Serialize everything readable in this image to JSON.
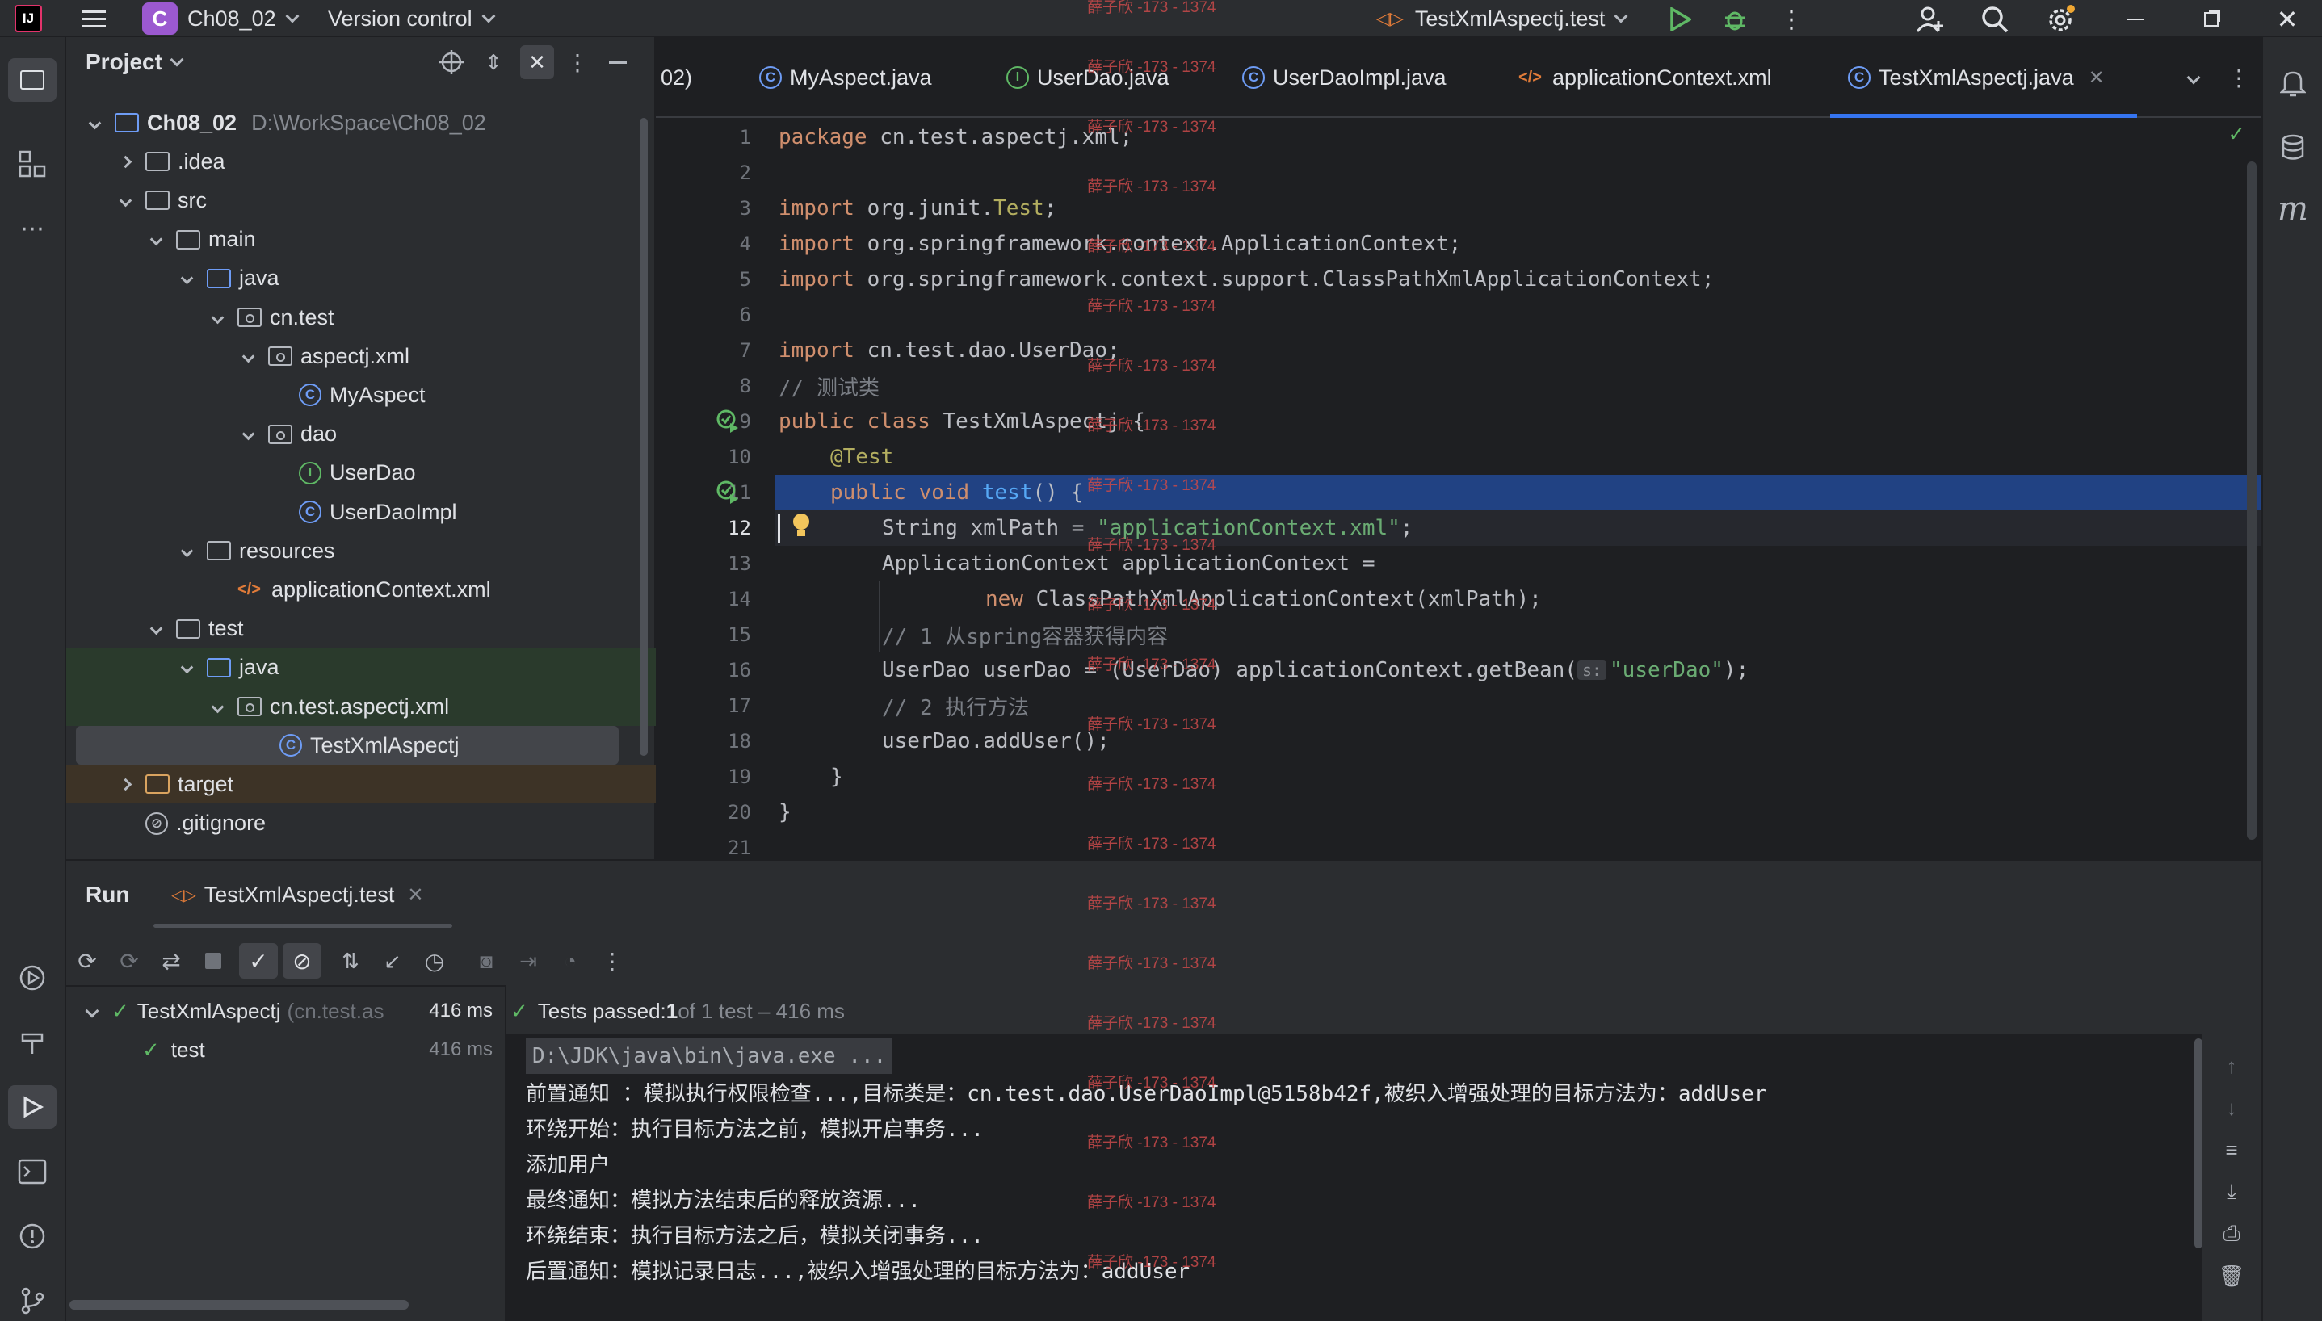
{
  "topbar": {
    "project_badge": "C",
    "project_name": "Ch08_02",
    "vcs": "Version control",
    "run_config": "TestXmlAspectj.test"
  },
  "project_panel": {
    "title": "Project",
    "tree": [
      {
        "label": "Ch08_02",
        "detail": "D:\\WorkSpace\\Ch08_02",
        "icon": "module-folder-icon"
      },
      {
        "label": ".idea",
        "icon": "folder-icon"
      },
      {
        "label": "src",
        "icon": "folder-icon"
      },
      {
        "label": "main",
        "icon": "folder-icon"
      },
      {
        "label": "java",
        "icon": "source-folder-icon"
      },
      {
        "label": "cn.test",
        "icon": "package-icon"
      },
      {
        "label": "aspectj.xml",
        "icon": "package-icon"
      },
      {
        "label": "MyAspect",
        "icon": "class-icon"
      },
      {
        "label": "dao",
        "icon": "package-icon"
      },
      {
        "label": "UserDao",
        "icon": "interface-icon"
      },
      {
        "label": "UserDaoImpl",
        "icon": "class-icon"
      },
      {
        "label": "resources",
        "icon": "resources-folder-icon"
      },
      {
        "label": "applicationContext.xml",
        "icon": "xml-icon"
      },
      {
        "label": "test",
        "icon": "folder-icon"
      },
      {
        "label": "java",
        "icon": "test-source-folder-icon"
      },
      {
        "label": "cn.test.aspectj.xml",
        "icon": "package-icon"
      },
      {
        "label": "TestXmlAspectj",
        "icon": "class-icon"
      },
      {
        "label": "target",
        "icon": "excluded-folder-icon"
      },
      {
        "label": ".gitignore",
        "icon": "ignore-icon"
      }
    ]
  },
  "editor": {
    "tabs": [
      {
        "label": "02)"
      },
      {
        "label": "MyAspect.java"
      },
      {
        "label": "UserDao.java"
      },
      {
        "label": "UserDaoImpl.java"
      },
      {
        "label": "applicationContext.xml"
      },
      {
        "label": "TestXmlAspectj.java"
      }
    ],
    "line_numbers": [
      "1",
      "2",
      "3",
      "4",
      "5",
      "6",
      "7",
      "8",
      "9",
      "10",
      "11",
      "12",
      "13",
      "14",
      "15",
      "16",
      "17",
      "18",
      "19",
      "20",
      "21"
    ],
    "code": {
      "l1_kw": "package",
      "l1_rest": " cn.test.aspectj.xml;",
      "l3_kw": "import",
      "l3_rest": " org.junit.",
      "l3_ann": "Test",
      "l3_end": ";",
      "l4_kw": "import",
      "l4_rest": " org.springframework.context.ApplicationContext;",
      "l5_kw": "import",
      "l5_rest": " org.springframework.context.support.ClassPathXmlApplicationContext;",
      "l7_kw": "import",
      "l7_rest": " cn.test.dao.UserDao;",
      "l8": "// 测试类",
      "l9_kw": "public class",
      "l9_rest": " TestXmlAspectj {",
      "l10": "@Test",
      "l11_kw": "public void",
      "l11_fn": " test",
      "l11_rest": "() {",
      "l12_a": "String xmlPath = ",
      "l12_str": "\"applicationContext.xml\"",
      "l12_end": ";",
      "l13": "ApplicationContext applicationContext =",
      "l14_kw": "new",
      "l14_rest": " ClassPathXmlApplicationContext(xmlPath);",
      "l15": "// 1 从spring容器获得内容",
      "l16_a": "UserDao userDao = (UserDao) applicationContext.getBean(",
      "l16_hint": "s:",
      "l16_str": "\"userDao\"",
      "l16_end": ");",
      "l17": "// 2 执行方法",
      "l18": "userDao.addUser();",
      "l19": "}",
      "l20": "}"
    },
    "watermark": "薛子欣 -173 - 1374"
  },
  "run_panel": {
    "title": "Run",
    "tab": "TestXmlAspectj.test",
    "tests": [
      {
        "name": "TestXmlAspectj",
        "detail": "(cn.test.as",
        "time": "416 ms"
      },
      {
        "name": "test",
        "detail": "",
        "time": "416 ms"
      }
    ],
    "status_prefix": "Tests passed: ",
    "status_count": "1",
    "status_suffix": " of 1 test – 416 ms",
    "console": [
      "D:\\JDK\\java\\bin\\java.exe ...",
      "前置通知 ：模拟执行权限检查...,目标类是：cn.test.dao.UserDaoImpl@5158b42f,被织入增强处理的目标方法为：addUser",
      "环绕开始：执行目标方法之前，模拟开启事务...",
      "添加用户",
      "最终通知：模拟方法结束后的释放资源...",
      "环绕结束：执行目标方法之后，模拟关闭事务...",
      "后置通知：模拟记录日志...,被织入增强处理的目标方法为：addUser"
    ]
  },
  "colors": {
    "accent": "#3574f0",
    "pass": "#5fb865",
    "watermark": "#c94a4a",
    "selection": "#214283"
  }
}
